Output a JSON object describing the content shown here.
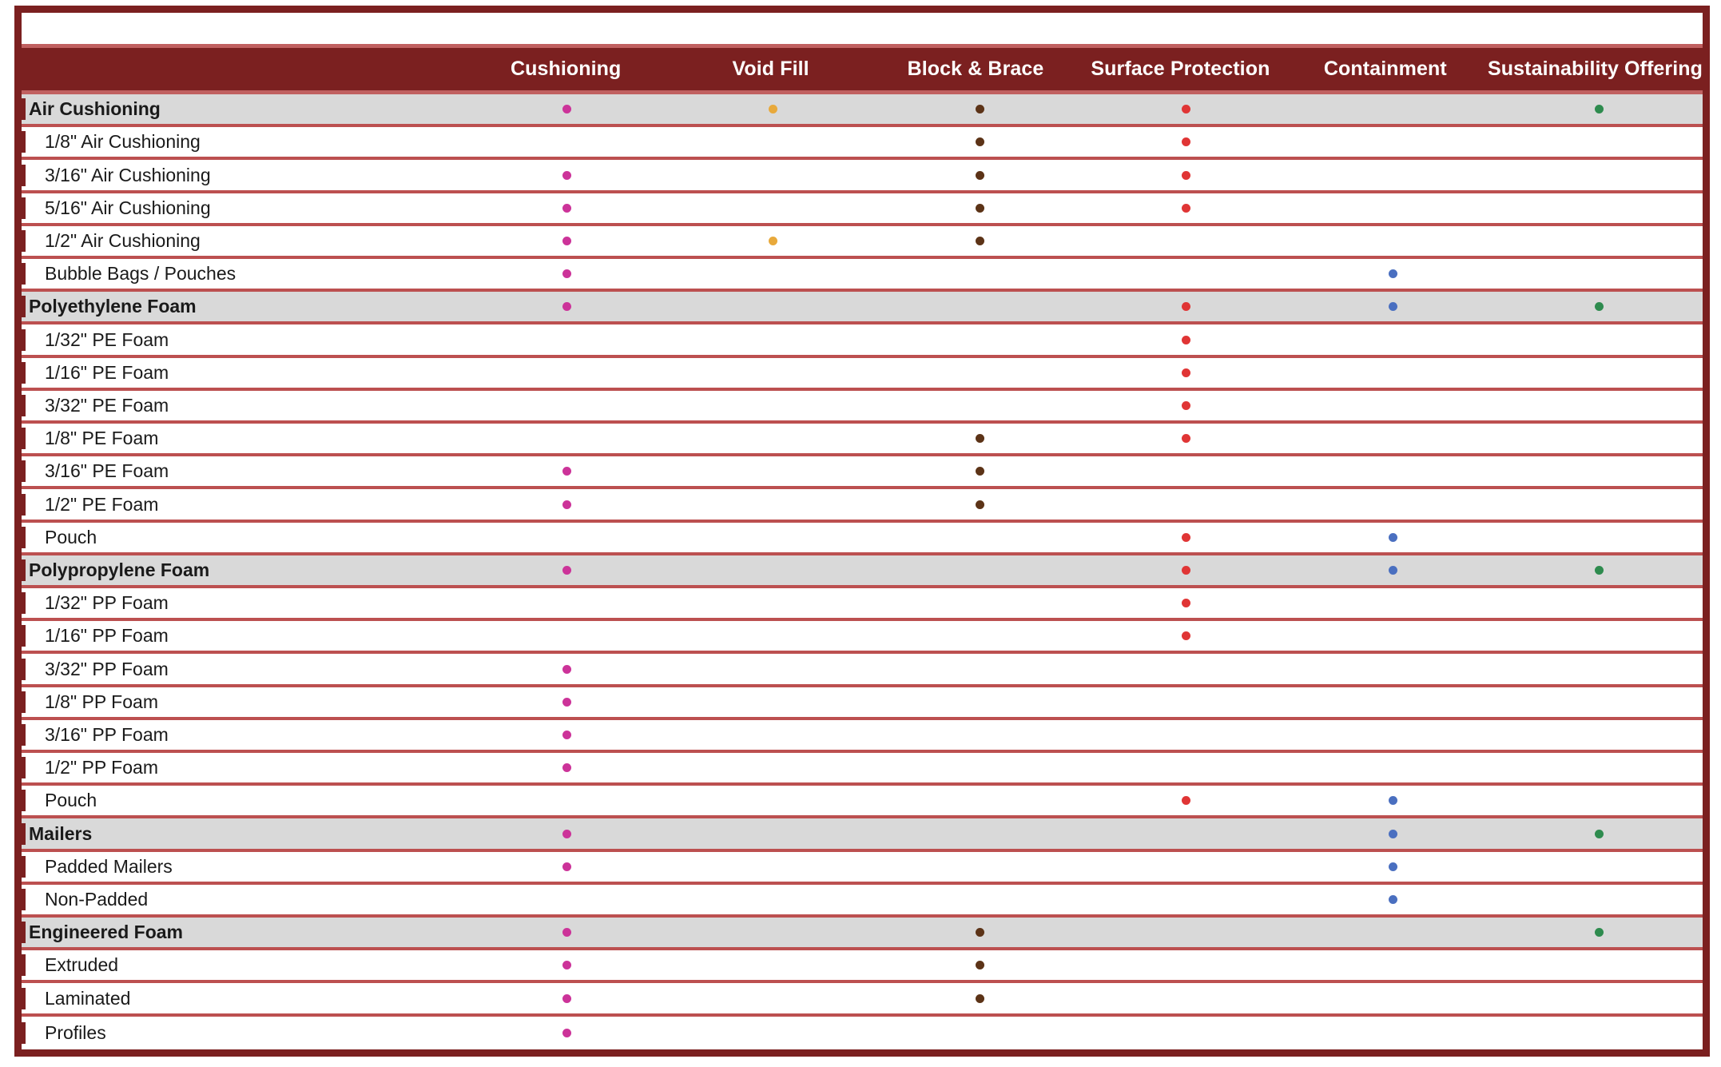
{
  "theme": {
    "frame_border": "#7B2020",
    "header_bg": "#7B2020",
    "header_text": "#FFFFFF",
    "row_separator": "#BC5050",
    "group_row_bg": "#D9D9D9",
    "row_bg": "#FFFFFF",
    "label_text": "#1A1A1A"
  },
  "title": "",
  "columns": [
    {
      "key": "cushioning",
      "label": "Cushioning",
      "dot_color": "#CC3399"
    },
    {
      "key": "void_fill",
      "label": "Void Fill",
      "dot_color": "#E8A93B"
    },
    {
      "key": "block_brace",
      "label": "Block & Brace",
      "dot_color": "#5C3317"
    },
    {
      "key": "surface_protection",
      "label": "Surface Protection",
      "dot_color": "#E03535"
    },
    {
      "key": "containment",
      "label": "Containment",
      "dot_color": "#4A6FC0"
    },
    {
      "key": "sustainability",
      "label": "Sustainability Offering",
      "dot_color": "#2E8B4E"
    }
  ],
  "rows": [
    {
      "label": "Air Cushioning",
      "group": true,
      "marks": [
        1,
        1,
        1,
        1,
        0,
        1
      ]
    },
    {
      "label": "1/8\" Air Cushioning",
      "group": false,
      "marks": [
        0,
        0,
        1,
        1,
        0,
        0
      ]
    },
    {
      "label": "3/16\" Air Cushioning",
      "group": false,
      "marks": [
        1,
        0,
        1,
        1,
        0,
        0
      ]
    },
    {
      "label": "5/16\"  Air Cushioning",
      "group": false,
      "marks": [
        1,
        0,
        1,
        1,
        0,
        0
      ]
    },
    {
      "label": "1/2\" Air Cushioning",
      "group": false,
      "marks": [
        1,
        1,
        1,
        0,
        0,
        0
      ]
    },
    {
      "label": "Bubble Bags / Pouches",
      "group": false,
      "marks": [
        1,
        0,
        0,
        0,
        1,
        0
      ]
    },
    {
      "label": "Polyethylene Foam",
      "group": true,
      "marks": [
        1,
        0,
        0,
        1,
        1,
        1
      ]
    },
    {
      "label": "1/32\" PE Foam",
      "group": false,
      "marks": [
        0,
        0,
        0,
        1,
        0,
        0
      ]
    },
    {
      "label": "1/16\"  PE Foam",
      "group": false,
      "marks": [
        0,
        0,
        0,
        1,
        0,
        0
      ]
    },
    {
      "label": "3/32\"  PE Foam",
      "group": false,
      "marks": [
        0,
        0,
        0,
        1,
        0,
        0
      ]
    },
    {
      "label": "1/8\"  PE Foam",
      "group": false,
      "marks": [
        0,
        0,
        1,
        1,
        0,
        0
      ]
    },
    {
      "label": "3/16\"  PE Foam",
      "group": false,
      "marks": [
        1,
        0,
        1,
        0,
        0,
        0
      ]
    },
    {
      "label": "1/2\"  PE Foam",
      "group": false,
      "marks": [
        1,
        0,
        1,
        0,
        0,
        0
      ]
    },
    {
      "label": "Pouch",
      "group": false,
      "marks": [
        0,
        0,
        0,
        1,
        1,
        0
      ]
    },
    {
      "label": "Polypropylene Foam",
      "group": true,
      "marks": [
        1,
        0,
        0,
        1,
        1,
        1
      ]
    },
    {
      "label": "1/32\" PP Foam",
      "group": false,
      "marks": [
        0,
        0,
        0,
        1,
        0,
        0
      ]
    },
    {
      "label": "1/16\" PP Foam",
      "group": false,
      "marks": [
        0,
        0,
        0,
        1,
        0,
        0
      ]
    },
    {
      "label": "3/32\" PP Foam",
      "group": false,
      "marks": [
        1,
        0,
        0,
        0,
        0,
        0
      ]
    },
    {
      "label": "1/8\" PP Foam",
      "group": false,
      "marks": [
        1,
        0,
        0,
        0,
        0,
        0
      ]
    },
    {
      "label": "3/16\" PP Foam",
      "group": false,
      "marks": [
        1,
        0,
        0,
        0,
        0,
        0
      ]
    },
    {
      "label": "1/2\" PP Foam",
      "group": false,
      "marks": [
        1,
        0,
        0,
        0,
        0,
        0
      ]
    },
    {
      "label": "Pouch",
      "group": false,
      "marks": [
        0,
        0,
        0,
        1,
        1,
        0
      ]
    },
    {
      "label": "Mailers",
      "group": true,
      "marks": [
        1,
        0,
        0,
        0,
        1,
        1
      ]
    },
    {
      "label": "Padded Mailers",
      "group": false,
      "marks": [
        1,
        0,
        0,
        0,
        1,
        0
      ]
    },
    {
      "label": "Non-Padded",
      "group": false,
      "marks": [
        0,
        0,
        0,
        0,
        1,
        0
      ]
    },
    {
      "label": "Engineered Foam",
      "group": true,
      "marks": [
        1,
        0,
        1,
        0,
        0,
        1
      ]
    },
    {
      "label": "Extruded",
      "group": false,
      "marks": [
        1,
        0,
        1,
        0,
        0,
        0
      ]
    },
    {
      "label": "Laminated",
      "group": false,
      "marks": [
        1,
        0,
        1,
        0,
        0,
        0
      ]
    },
    {
      "label": "Profiles",
      "group": false,
      "marks": [
        1,
        0,
        0,
        0,
        0,
        0
      ]
    }
  ]
}
